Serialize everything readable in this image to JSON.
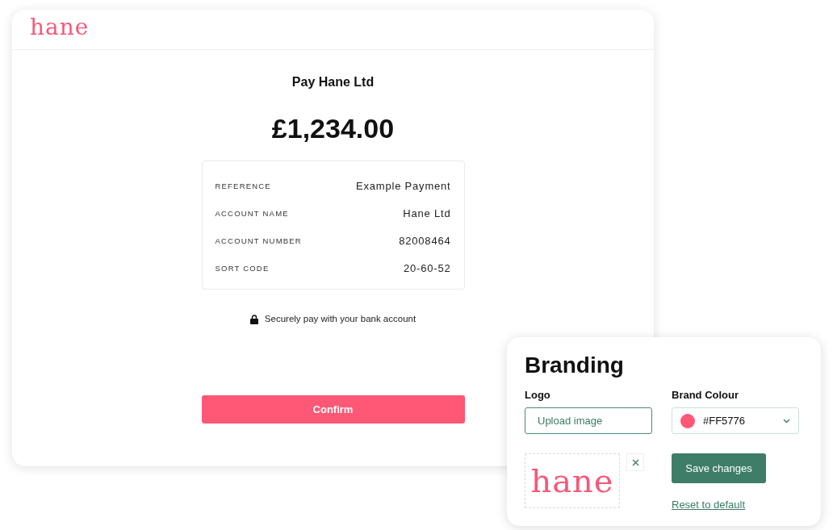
{
  "payment_page": {
    "logo": "hane",
    "title": "Pay Hane Ltd",
    "amount": "£1,234.00",
    "details": [
      {
        "label": "REFERENCE",
        "value": "Example Payment"
      },
      {
        "label": "ACCOUNT NAME",
        "value": "Hane Ltd"
      },
      {
        "label": "ACCOUNT NUMBER",
        "value": "82008464"
      },
      {
        "label": "SORT CODE",
        "value": "20-60-52"
      }
    ],
    "security_note": "Securely pay with your bank account",
    "confirm_button": "Confirm"
  },
  "branding": {
    "title": "Branding",
    "logo_label": "Logo",
    "upload_button": "Upload image",
    "logo_preview": "hane",
    "colour_label": "Brand Colour",
    "colour": {
      "value": "#FF5776",
      "color": "#ff5776"
    },
    "save_button": "Save changes",
    "reset_link": "Reset to default"
  }
}
